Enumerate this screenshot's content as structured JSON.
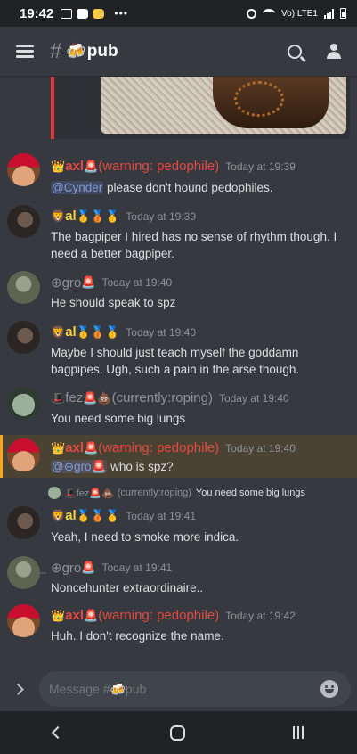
{
  "status_bar": {
    "time": "19:42",
    "network": "Vo) LTE1"
  },
  "header": {
    "hash": "#",
    "channel_emoji": "🍻",
    "channel_name": "pub"
  },
  "messages": [
    {
      "avatar": "maga-hat-avatar",
      "name_prefix": "👑",
      "name": "axl",
      "name_suffix": "🚨",
      "name_tail": "(warning: pedophile)",
      "timestamp": "Today at 19:39",
      "mention": "@Cynder",
      "text": " please don't hound pedophiles."
    },
    {
      "avatar": "al-avatar",
      "name_prefix": "🦁",
      "name": "al",
      "name_suffix": "🥇🥉🥇",
      "timestamp": "Today at 19:39",
      "text": "The bagpiper I hired has no sense of rhythm though. I need a better bagpiper."
    },
    {
      "avatar": "gro-avatar",
      "name_prefix": "⊕",
      "name": "gro",
      "name_suffix": "🚨",
      "timestamp": "Today at 19:40",
      "text": "He should speak to spz"
    },
    {
      "avatar": "al-avatar",
      "name_prefix": "🦁",
      "name": "al",
      "name_suffix": "🥇🥉🥇",
      "timestamp": "Today at 19:40",
      "text": "Maybe I should just teach myself the goddamn bagpipes. Ugh, such a pain in the arse though."
    },
    {
      "avatar": "fez-avatar",
      "name_prefix": "🎩",
      "name": "fez",
      "name_suffix": "🚨💩",
      "name_tail": "(currently:roping)",
      "timestamp": "Today at 19:40",
      "text": "You need some big lungs"
    },
    {
      "avatar": "maga-hat-avatar",
      "name_prefix": "👑",
      "name": "axl",
      "name_suffix": "🚨",
      "name_tail": "(warning: pedophile)",
      "timestamp": "Today at 19:40",
      "mention": "@⊕gro🚨",
      "text": " who is spz?"
    },
    {
      "avatar": "al-avatar",
      "name_prefix": "🦁",
      "name": "al",
      "name_suffix": "🥇🥉🥇",
      "timestamp": "Today at 19:41",
      "text": "Yeah, I need to smoke more indica."
    },
    {
      "avatar": "gro-avatar",
      "name_prefix": "⊕",
      "name": "gro",
      "name_suffix": "🚨",
      "timestamp": "Today at 19:41",
      "text": "Noncehunter extraordinaire.."
    },
    {
      "avatar": "maga-hat-avatar",
      "name_prefix": "👑",
      "name": "axl",
      "name_suffix": "🚨",
      "name_tail": "(warning: pedophile)",
      "timestamp": "Today at 19:42",
      "text": "Huh. I don't recognize the name."
    }
  ],
  "reply": {
    "user": "🎩fez🚨💩",
    "user_tail": "(currently:roping)",
    "text": "You need some big lungs"
  },
  "input": {
    "placeholder": "Message #🍻pub"
  }
}
